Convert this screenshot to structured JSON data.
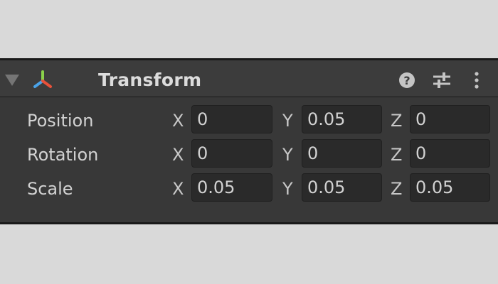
{
  "component": {
    "title": "Transform",
    "icons": {
      "foldout": "foldout-arrow-down-icon",
      "component": "transform-axes-icon",
      "help": "help-question-icon",
      "presets": "presets-sliders-icon",
      "menu": "vertical-ellipsis-menu-icon"
    }
  },
  "rows": [
    {
      "label": "Position",
      "x": {
        "axis": "X",
        "value": "0"
      },
      "y": {
        "axis": "Y",
        "value": "0.05"
      },
      "z": {
        "axis": "Z",
        "value": "0"
      }
    },
    {
      "label": "Rotation",
      "x": {
        "axis": "X",
        "value": "0"
      },
      "y": {
        "axis": "Y",
        "value": "0"
      },
      "z": {
        "axis": "Z",
        "value": "0"
      }
    },
    {
      "label": "Scale",
      "x": {
        "axis": "X",
        "value": "0.05"
      },
      "y": {
        "axis": "Y",
        "value": "0.05"
      },
      "z": {
        "axis": "Z",
        "value": "0.05"
      }
    }
  ],
  "colors": {
    "page_background": "#d9d9d9",
    "header_background": "#3c3c3c",
    "body_background": "#383838",
    "field_background": "#2a2a2a",
    "axis_green": "#8ad14a",
    "axis_blue": "#4aa3e8",
    "axis_red": "#e8513a"
  }
}
